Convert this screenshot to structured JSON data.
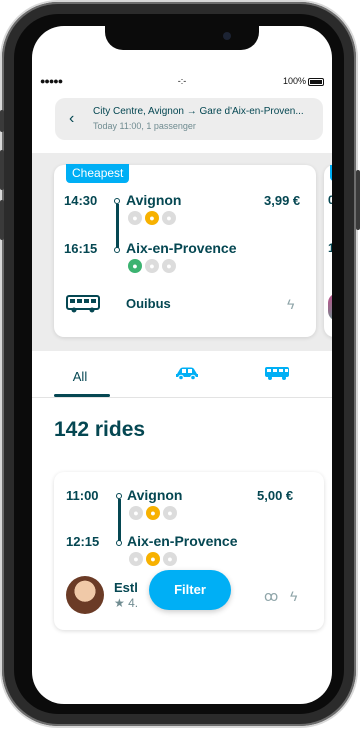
{
  "status_bar": {
    "signal": "●●●●●",
    "time": "-:-",
    "battery_pct": "100%"
  },
  "search": {
    "route": "City Centre, Avignon → Gare d'Aix-en-Proven...",
    "meta": "Today 11:00, 1 passenger",
    "back_icon": "‹"
  },
  "featured": {
    "badge": "Cheapest",
    "departure_time": "14:30",
    "departure_city": "Avignon",
    "arrival_time": "16:15",
    "arrival_city": "Aix-en-Provence",
    "price": "3,99 €",
    "operator": "Ouibus",
    "bolt_icon": "ϟ",
    "peek_badge_letter": "C",
    "peek_time_1": "0",
    "peek_time_2": "1"
  },
  "tabs": {
    "all": "All",
    "car_icon": "car-icon",
    "bus_icon": "bus-icon"
  },
  "results": {
    "count": "142 rides"
  },
  "ride": {
    "departure_time": "11:00",
    "departure_city": "Avignon",
    "arrival_time": "12:15",
    "arrival_city": "Aix-en-Provence",
    "price": "5,00 €",
    "driver": "Estl",
    "rating": "★ 4.",
    "seats_icon": "ꝏ",
    "bolt_icon": "ϟ"
  },
  "filter": {
    "label": "Filter"
  },
  "colors": {
    "brand": "#00aff5",
    "primary_text": "#054752",
    "muted": "#708c91",
    "yellow": "#f7b100",
    "green": "#3cb371"
  }
}
